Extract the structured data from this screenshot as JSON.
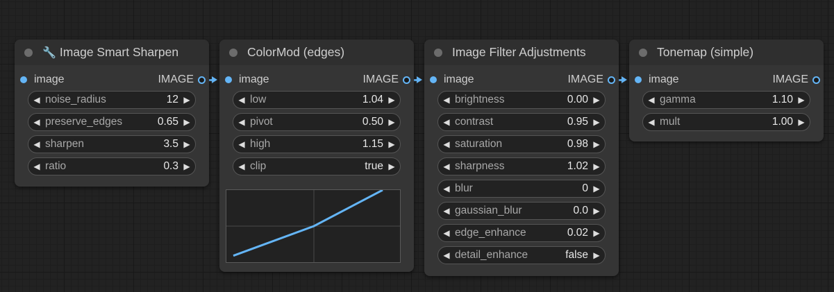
{
  "nodes": {
    "sharpen": {
      "title": "Image Smart Sharpen",
      "title_icon": "wrench-icon",
      "input_label": "image",
      "output_label": "IMAGE",
      "widgets": [
        {
          "label": "noise_radius",
          "value": "12"
        },
        {
          "label": "preserve_edges",
          "value": "0.65"
        },
        {
          "label": "sharpen",
          "value": "3.5"
        },
        {
          "label": "ratio",
          "value": "0.3"
        }
      ]
    },
    "colormod": {
      "title": "ColorMod (edges)",
      "input_label": "image",
      "output_label": "IMAGE",
      "widgets": [
        {
          "label": "low",
          "value": "1.04"
        },
        {
          "label": "pivot",
          "value": "0.50"
        },
        {
          "label": "high",
          "value": "1.15"
        },
        {
          "label": "clip",
          "value": "true"
        }
      ],
      "curve": {
        "low": 1.04,
        "pivot": 0.5,
        "high": 1.15,
        "color": "#64b5f6"
      }
    },
    "filter": {
      "title": "Image Filter Adjustments",
      "input_label": "image",
      "output_label": "IMAGE",
      "widgets": [
        {
          "label": "brightness",
          "value": "0.00"
        },
        {
          "label": "contrast",
          "value": "0.95"
        },
        {
          "label": "saturation",
          "value": "0.98"
        },
        {
          "label": "sharpness",
          "value": "1.02"
        },
        {
          "label": "blur",
          "value": "0"
        },
        {
          "label": "gaussian_blur",
          "value": "0.0"
        },
        {
          "label": "edge_enhance",
          "value": "0.02"
        },
        {
          "label": "detail_enhance",
          "value": "false"
        }
      ]
    },
    "tonemap": {
      "title": "Tonemap (simple)",
      "input_label": "image",
      "output_label": "IMAGE",
      "widgets": [
        {
          "label": "gamma",
          "value": "1.10"
        },
        {
          "label": "mult",
          "value": "1.00"
        }
      ]
    }
  },
  "colors": {
    "link": "#64b5f6",
    "canvas": "#222222",
    "node_body": "#353535"
  },
  "icons": {
    "widget_decrement": "left-arrow-icon",
    "widget_increment": "right-arrow-icon"
  }
}
